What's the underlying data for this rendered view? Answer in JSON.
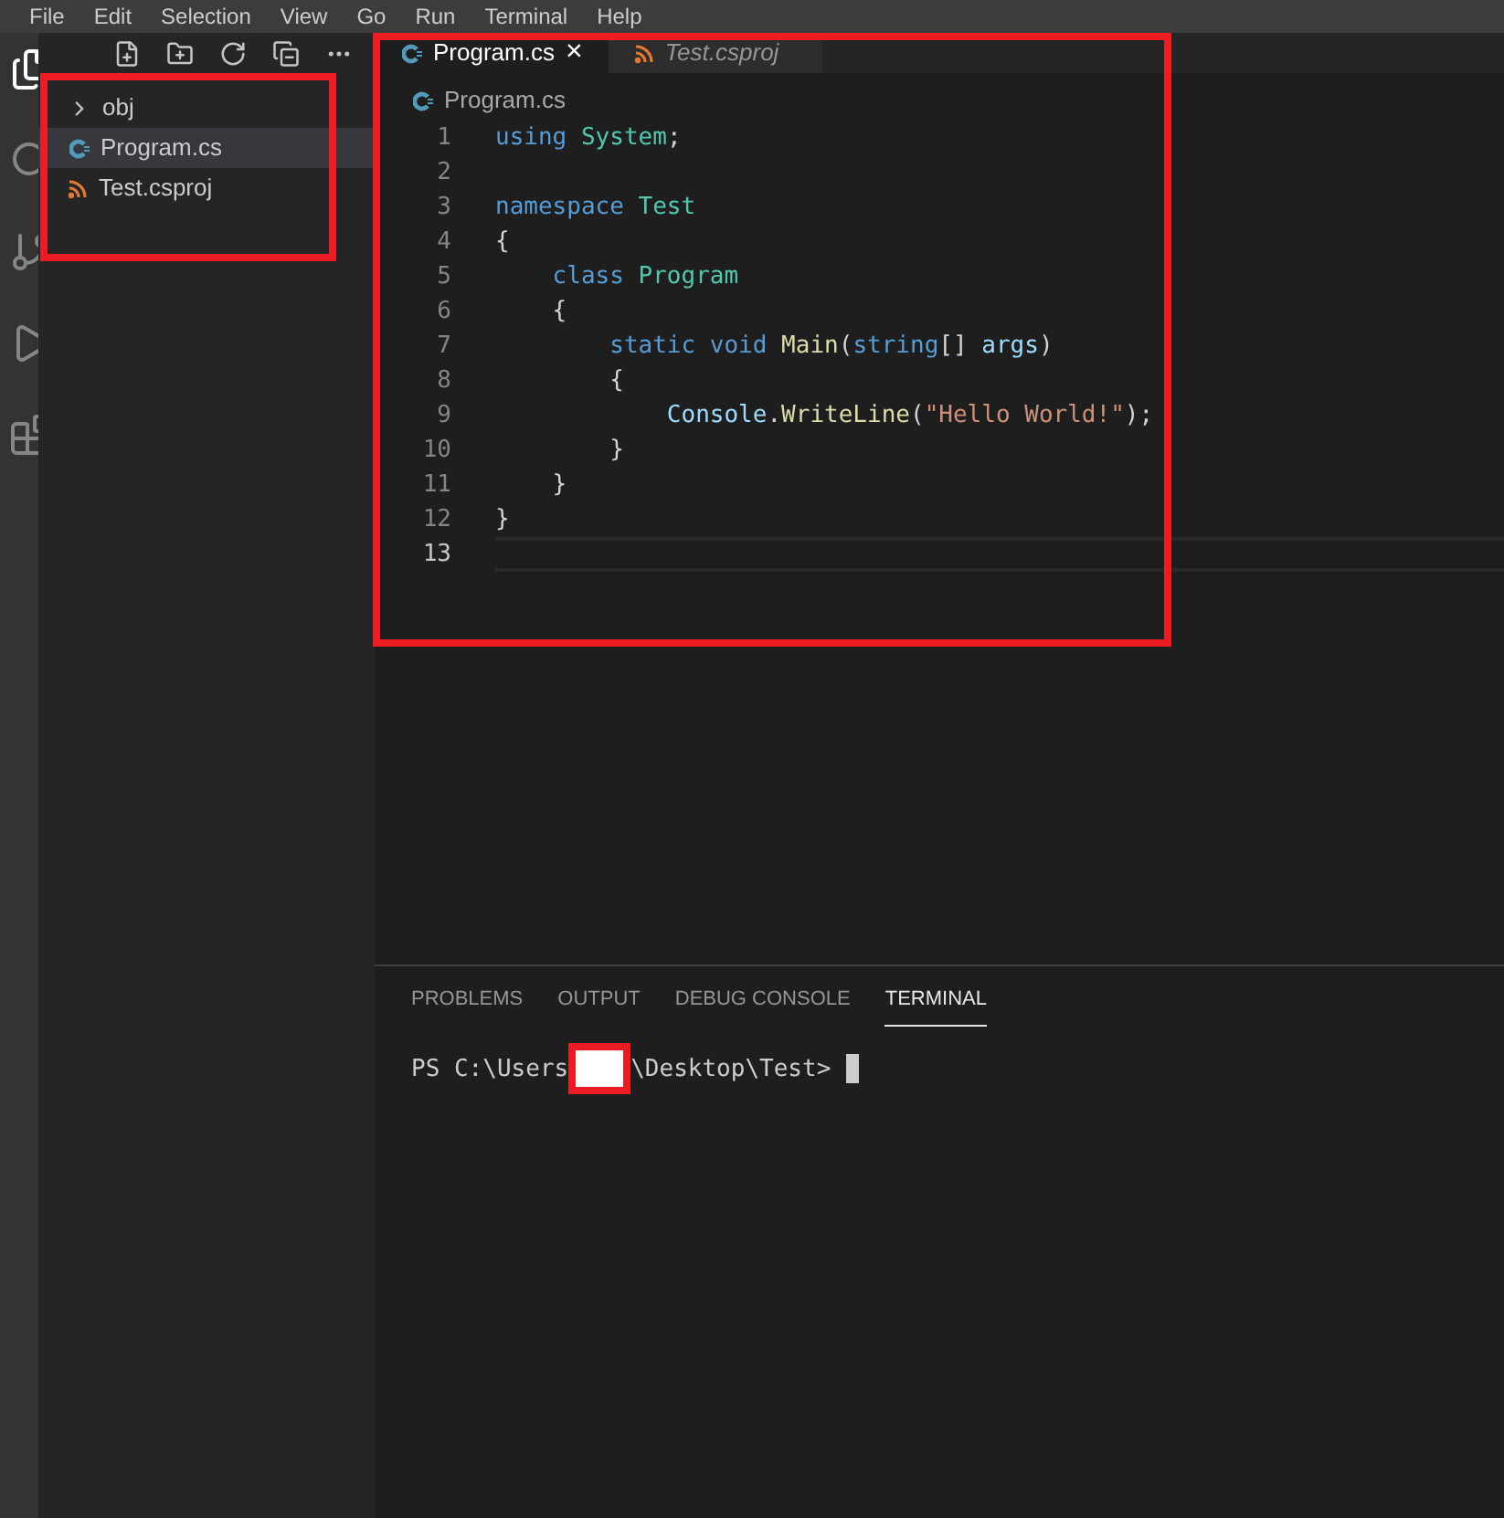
{
  "menu": [
    "File",
    "Edit",
    "Selection",
    "View",
    "Go",
    "Run",
    "Terminal",
    "Help"
  ],
  "explorer": {
    "items": [
      {
        "label": "obj",
        "kind": "folder",
        "expanded": false,
        "selected": false
      },
      {
        "label": "Program.cs",
        "kind": "csharp",
        "selected": true
      },
      {
        "label": "Test.csproj",
        "kind": "msbuild",
        "selected": false
      }
    ]
  },
  "tabs": [
    {
      "label": "Program.cs",
      "kind": "csharp",
      "selected": true,
      "preview": false,
      "close": "×"
    },
    {
      "label": "Test.csproj",
      "kind": "msbuild",
      "selected": false,
      "preview": true
    }
  ],
  "breadcrumb": {
    "label": "Program.cs",
    "kind": "csharp"
  },
  "code": [
    {
      "number": "1",
      "current": false,
      "tokens": [
        {
          "text": "using ",
          "kind": "keyword"
        },
        {
          "text": "System",
          "kind": "type"
        },
        {
          "text": ";",
          "kind": "plain"
        }
      ]
    },
    {
      "number": "2",
      "current": false
    },
    {
      "number": "3",
      "current": false,
      "tokens": [
        {
          "text": "namespace ",
          "kind": "keyword"
        },
        {
          "text": "Test",
          "kind": "type"
        }
      ]
    },
    {
      "number": "4",
      "current": false,
      "tokens": [
        {
          "text": "{",
          "kind": "plain"
        }
      ]
    },
    {
      "number": "5",
      "current": false,
      "tokens": [
        {
          "text": "    class ",
          "kind": "keyword"
        },
        {
          "text": "Program",
          "kind": "type"
        }
      ]
    },
    {
      "number": "6",
      "current": false,
      "tokens": [
        {
          "text": "    {",
          "kind": "plain"
        }
      ]
    },
    {
      "number": "7",
      "current": false,
      "tokens": [
        {
          "text": "        static void ",
          "kind": "keyword"
        },
        {
          "text": "Main",
          "kind": "method"
        },
        {
          "text": "(",
          "kind": "plain"
        },
        {
          "text": "string",
          "kind": "keyword"
        },
        {
          "text": "[] ",
          "kind": "plain"
        },
        {
          "text": "args",
          "kind": "param"
        },
        {
          "text": ")",
          "kind": "plain"
        }
      ]
    },
    {
      "number": "8",
      "current": false,
      "tokens": [
        {
          "text": "        {",
          "kind": "plain"
        }
      ]
    },
    {
      "number": "9",
      "current": false,
      "tokens": [
        {
          "text": "            Console",
          "kind": "param"
        },
        {
          "text": ".",
          "kind": "plain"
        },
        {
          "text": "WriteLine",
          "kind": "method"
        },
        {
          "text": "(",
          "kind": "plain"
        },
        {
          "text": "\"Hello World!\"",
          "kind": "string"
        },
        {
          "text": ");",
          "kind": "plain"
        }
      ]
    },
    {
      "number": "10",
      "current": false,
      "tokens": [
        {
          "text": "        }",
          "kind": "plain"
        }
      ]
    },
    {
      "number": "11",
      "current": false,
      "tokens": [
        {
          "text": "    }",
          "kind": "plain"
        }
      ]
    },
    {
      "number": "12",
      "current": false,
      "tokens": [
        {
          "text": "}",
          "kind": "plain"
        }
      ]
    },
    {
      "number": "13",
      "current": true
    }
  ],
  "panel": {
    "tabs": [
      {
        "label": "PROBLEMS",
        "selected": false
      },
      {
        "label": "OUTPUT",
        "selected": false
      },
      {
        "label": "DEBUG CONSOLE",
        "selected": false
      },
      {
        "label": "TERMINAL",
        "selected": true
      }
    ],
    "terminal": {
      "prompt_start": "PS C:\\Users",
      "prompt_end": "\\Desktop\\Test>"
    }
  }
}
